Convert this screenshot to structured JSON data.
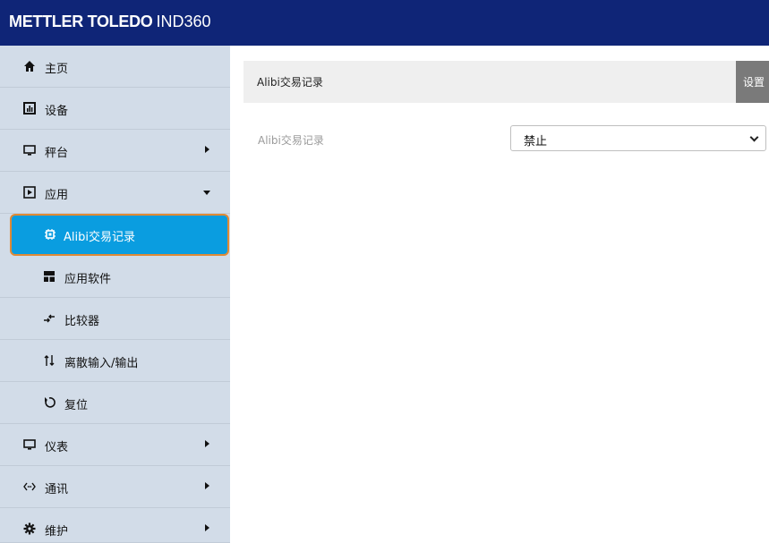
{
  "header": {
    "brand": "METTLER TOLEDO",
    "model": "IND360"
  },
  "sidebar": {
    "items": [
      {
        "label": "主页",
        "icon": "home-icon"
      },
      {
        "label": "设备",
        "icon": "chart-icon"
      },
      {
        "label": "秤台",
        "icon": "monitor-icon"
      },
      {
        "label": "应用",
        "icon": "play-box-icon"
      },
      {
        "label": "Alibi交易记录",
        "icon": "chip-icon"
      },
      {
        "label": "应用软件",
        "icon": "app-icon"
      },
      {
        "label": "比较器",
        "icon": "compare-icon"
      },
      {
        "label": "离散输入/输出",
        "icon": "io-icon"
      },
      {
        "label": "复位",
        "icon": "reset-icon"
      },
      {
        "label": "仪表",
        "icon": "monitor-icon"
      },
      {
        "label": "通讯",
        "icon": "code-icon"
      },
      {
        "label": "维护",
        "icon": "gear-icon"
      }
    ]
  },
  "main": {
    "title": "Alibi交易记录",
    "settings_label": "设置",
    "field_label": "Alibi交易记录",
    "field_value": "禁止"
  },
  "colors": {
    "topbar": "#0f2577",
    "sidebar": "#d2dce8",
    "active": "#0a9de0",
    "active_border": "#e08a35"
  }
}
